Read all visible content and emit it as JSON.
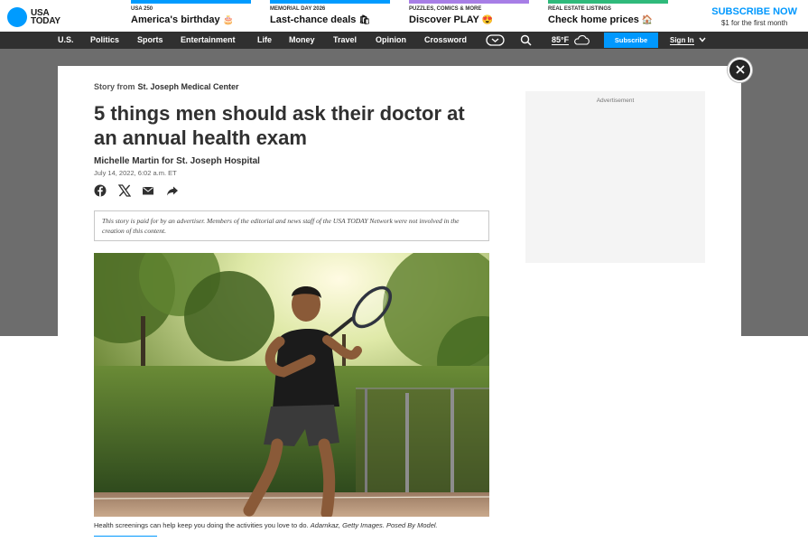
{
  "brand": {
    "logo_line1": "USA",
    "logo_line2": "TODAY"
  },
  "promos": [
    {
      "kicker": "USA 250",
      "title": "America's birthday",
      "emoji": "🎂",
      "color": "#009bff"
    },
    {
      "kicker": "MEMORIAL DAY 2026",
      "title": "Last-chance deals",
      "emoji": "🛍",
      "color": "#009bff"
    },
    {
      "kicker": "PUZZLES, COMICS & MORE",
      "title": "Discover PLAY",
      "emoji": "😍",
      "color": "#a77ee6"
    },
    {
      "kicker": "REAL ESTATE LISTINGS",
      "title": "Check home prices",
      "emoji": "🏠",
      "color": "#2fba7b"
    }
  ],
  "subscribe_cta": {
    "headline": "SUBSCRIBE NOW",
    "offer": "$1 for the first month"
  },
  "nav": {
    "items": [
      "U.S.",
      "Politics",
      "Sports",
      "Entertainment",
      "Life",
      "Money",
      "Travel",
      "Opinion",
      "Crossword"
    ],
    "weather": "85°F",
    "subscribe": "Subscribe",
    "signin": "Sign In"
  },
  "article": {
    "story_from_label": "Story from",
    "sponsor": "St. Joseph Medical Center",
    "headline": "5 things men should ask their doctor at an annual health exam",
    "byline": "Michelle Martin for St. Joseph Hospital",
    "date": "July 14, 2022, 6:02 a.m. ET",
    "disclaimer": "This story is paid for by an advertiser. Members of the editorial and news staff of the USA TODAY Network were not involved in the creation of this content.",
    "caption": "Health screenings can help keep you doing the activities you love to do.",
    "credit": "Adamkaz, Getty Images. Posed By Model."
  },
  "ad": {
    "label": "Advertisement"
  },
  "icons": [
    "facebook-icon",
    "x-icon",
    "email-icon",
    "share-icon",
    "search-icon",
    "games-icon",
    "weather-cloud-icon",
    "chevron-down-icon",
    "close-icon"
  ]
}
